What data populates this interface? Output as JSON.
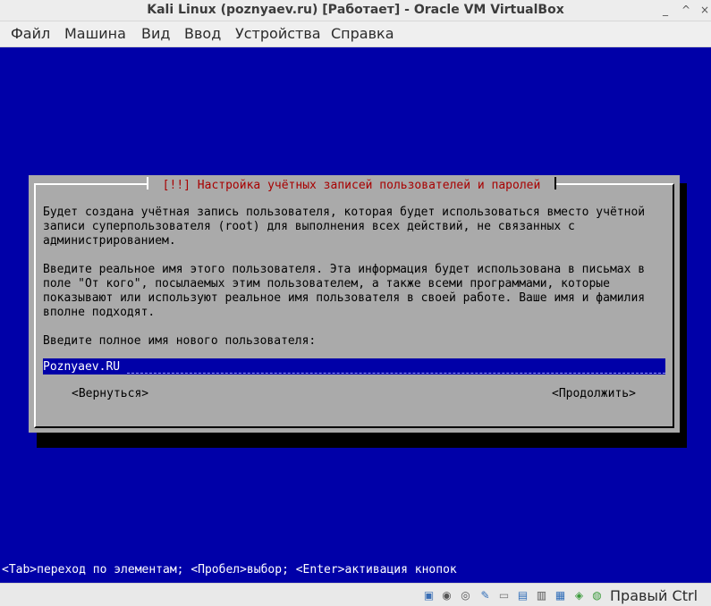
{
  "window": {
    "title": "Kali Linux (poznyaev.ru) [Работает] - Oracle VM VirtualBox",
    "minimize_glyph": "_",
    "maximize_glyph": "^",
    "close_glyph": "×"
  },
  "menu": {
    "items": [
      "Файл",
      "Машина",
      "Вид",
      "Ввод",
      "Устройства",
      "Справка"
    ]
  },
  "installer": {
    "title": " [!!] Настройка учётных записей пользователей и паролей ",
    "paragraph1": "Будет создана учётная запись пользователя, которая будет использоваться вместо учётной\nзаписи суперпользователя (root) для выполнения всех действий, не связанных с\nадминистрированием.",
    "paragraph2": "Введите реальное имя этого пользователя. Эта информация будет использована в письмах в\nполе \"От кого\", посылаемых этим пользователем, а также всеми программами, которые\nпоказывают или используют реальное имя пользователя в своей работе. Ваше имя и фамилия\nвполне подходят.",
    "prompt": "Введите полное имя нового пользователя:",
    "full_name_value": "Poznyaev.RU",
    "back_button": "<Вернуться>",
    "continue_button": "<Продолжить>",
    "hint": "<Tab>переход по элементам; <Пробел>выбор; <Enter>активация кнопок"
  },
  "statusbar": {
    "icons": [
      "hard-disk-icon",
      "optical-drive-icon",
      "audio-icon",
      "network-icon",
      "usb-icon",
      "shared-folders-icon",
      "display-icon",
      "recording-icon",
      "cpu-virtualization-icon",
      "mouse-integration-icon",
      "keyboard-capture-icon"
    ],
    "host_key": "Правый Ctrl",
    "colors": {
      "vm_background": "#0000a8",
      "dialog_gray": "#aaaaaa",
      "title_red": "#a80000"
    }
  }
}
